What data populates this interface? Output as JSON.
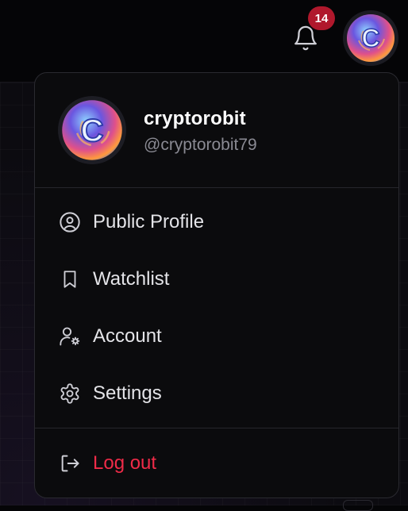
{
  "notifications": {
    "count": "14",
    "icon": "bell-icon",
    "badge_color": "#b0182c"
  },
  "user": {
    "display_name": "cryptorobit",
    "handle": "@cryptorobit79",
    "avatar_letter": "C"
  },
  "menu": {
    "items": [
      {
        "label": "Public Profile",
        "icon": "user-circle-icon"
      },
      {
        "label": "Watchlist",
        "icon": "bookmark-icon"
      },
      {
        "label": "Account",
        "icon": "user-cog-icon"
      },
      {
        "label": "Settings",
        "icon": "gear-icon"
      }
    ],
    "logout": {
      "label": "Log out",
      "icon": "logout-icon",
      "color": "#ef2b48"
    }
  }
}
